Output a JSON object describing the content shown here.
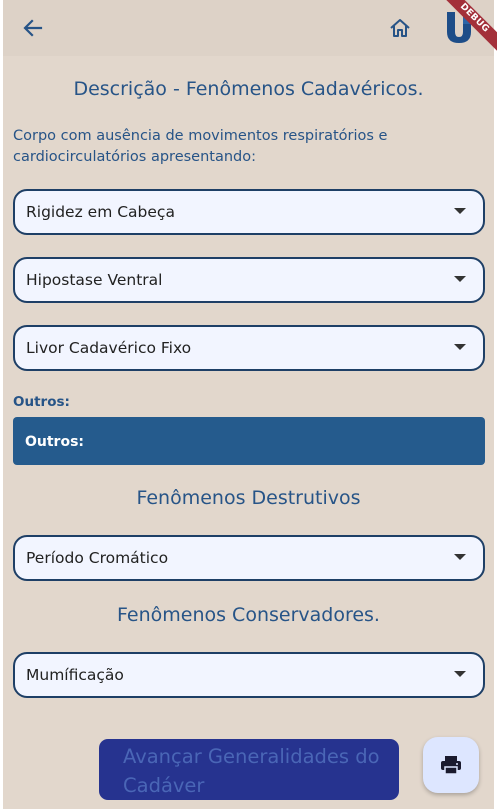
{
  "appbar": {
    "back_icon": "arrow-left-icon",
    "home_icon": "home-icon",
    "logo_icon": "app-logo-icon",
    "debug_label": "DEBUG"
  },
  "section_descricao": {
    "title": "Descrição - Fenômenos Cadavéricos.",
    "intro": "Corpo com ausência de movimentos respiratórios e cardiocirculatórios apresentando:"
  },
  "dropdowns": {
    "rigidez": "Rigidez em Cabeça",
    "hipostase": "Hipostase Ventral",
    "livor": "Livor Cadavérico Fixo"
  },
  "outros": {
    "label": "Outros:",
    "hint": "Outros:"
  },
  "section_destrutivos": {
    "title": "Fenômenos Destrutivos",
    "value": "Período Cromático"
  },
  "section_conservadores": {
    "title": "Fenômenos Conservadores.",
    "value": "Mumíficação"
  },
  "actions": {
    "advance_label": "Avançar Generalidades do Cadáver",
    "print_icon": "printer-icon"
  },
  "colors": {
    "background": "#e2d7cc",
    "primary_text": "#275487",
    "field_fill": "#f2f5ff",
    "outros_fill": "#255b8d",
    "advance_button": "#26338f",
    "print_button": "#dde6ff"
  }
}
